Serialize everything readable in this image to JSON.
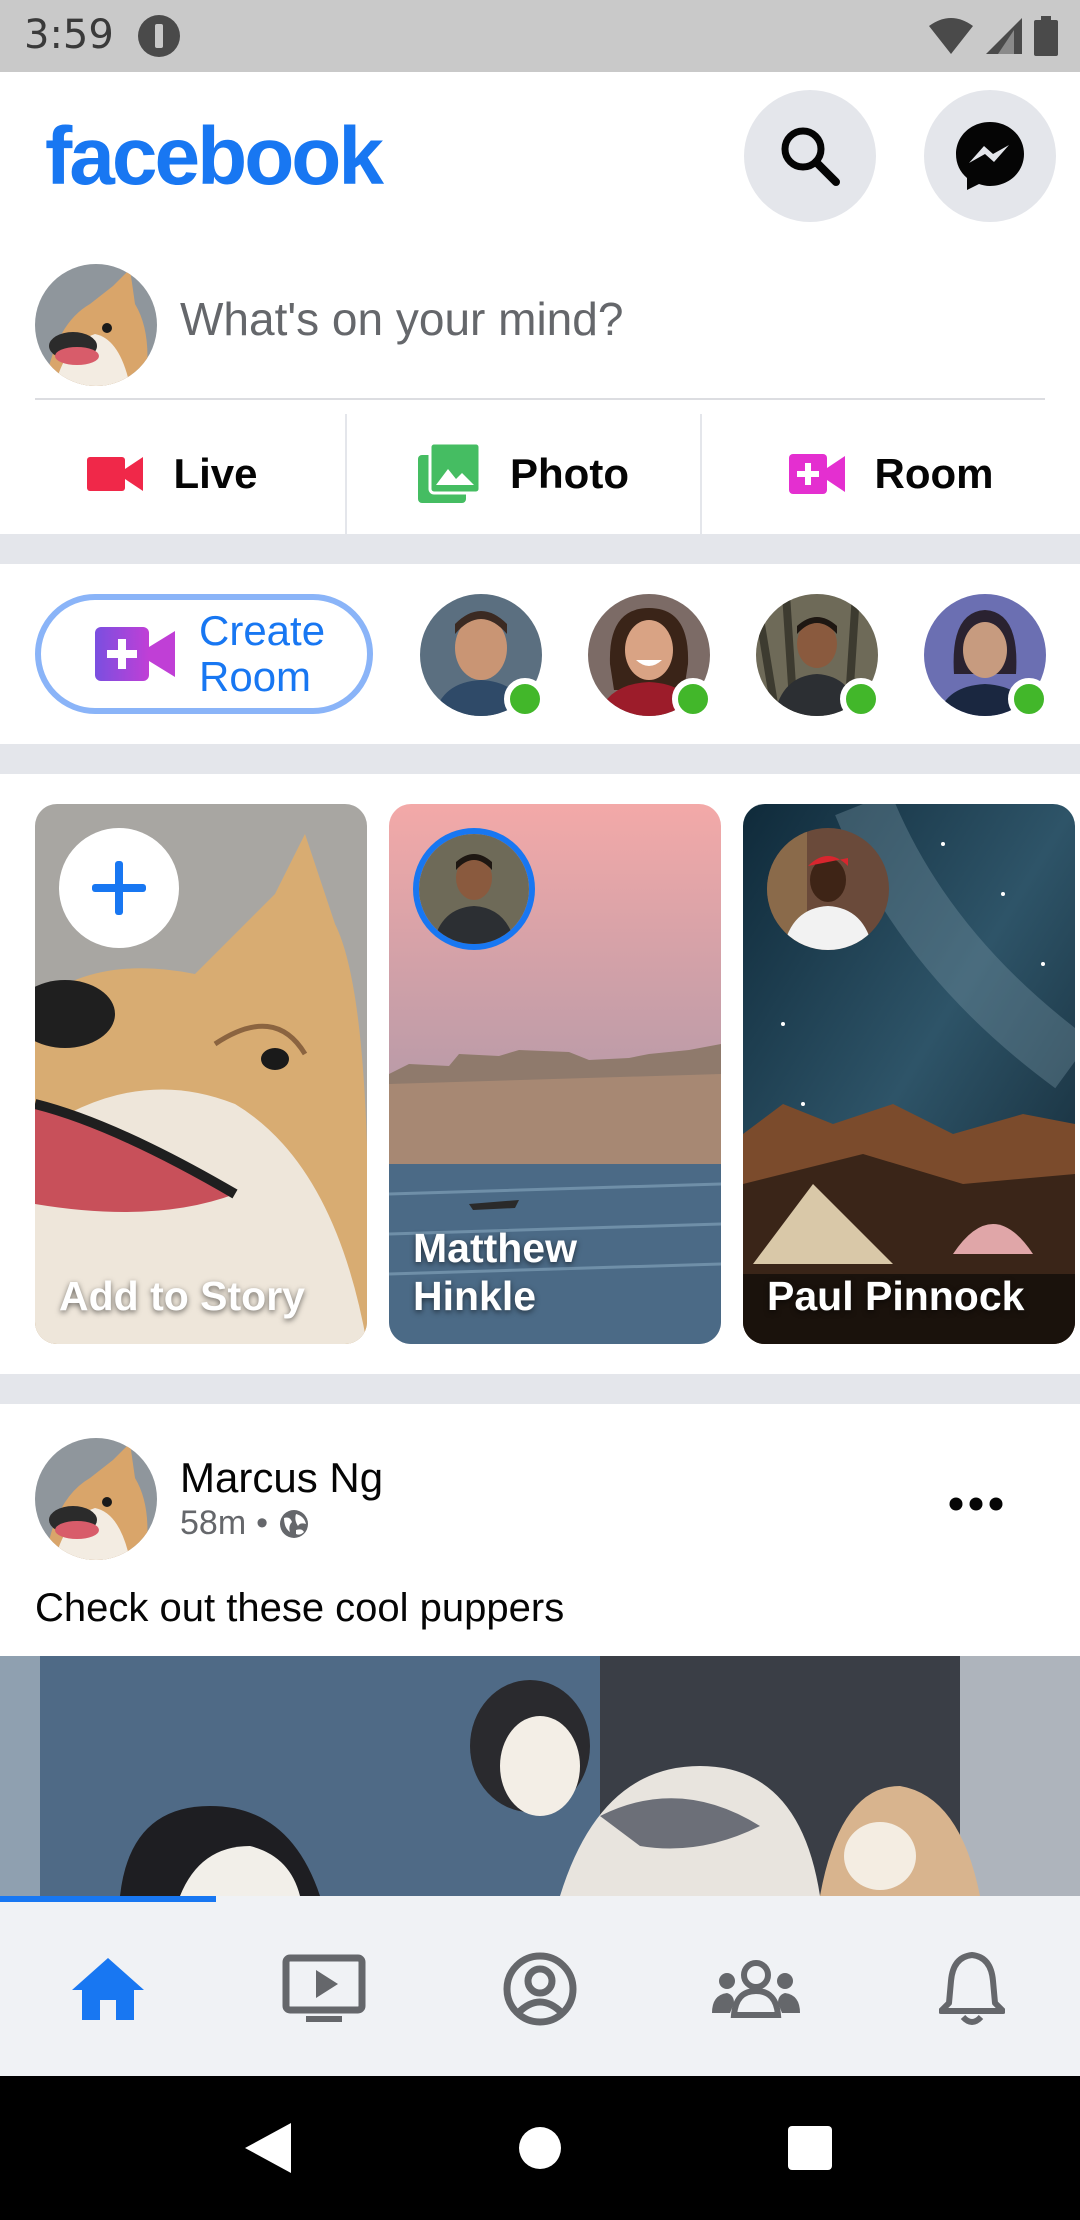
{
  "status_bar": {
    "time": "3:59",
    "icons": [
      "notification-icon",
      "wifi-icon",
      "signal-icon",
      "battery-icon"
    ]
  },
  "header": {
    "logo": "facebook",
    "search_icon": "search-icon",
    "messenger_icon": "messenger-icon"
  },
  "composer": {
    "placeholder": "What's on your mind?",
    "actions": [
      {
        "label": "Live",
        "icon": "video-camera-icon",
        "color": "#f02849"
      },
      {
        "label": "Photo",
        "icon": "photo-icon",
        "color": "#45bd62"
      },
      {
        "label": "Room",
        "icon": "room-icon",
        "color": "#e42fd0"
      }
    ]
  },
  "rooms": {
    "create_line1": "Create",
    "create_line2": "Room",
    "contacts_online": 4
  },
  "stories": [
    {
      "name": "Add to Story",
      "type": "add"
    },
    {
      "name": "Matthew Hinkle",
      "type": "story",
      "unseen": true
    },
    {
      "name": "Paul Pinnock",
      "type": "story",
      "unseen": false
    }
  ],
  "post": {
    "author": "Marcus Ng",
    "time": "58m",
    "separator": "•",
    "privacy_icon": "globe-icon",
    "text": "Check out these cool puppers"
  },
  "bottom_nav": {
    "items": [
      "home-icon",
      "watch-icon",
      "profile-icon",
      "groups-icon",
      "notifications-icon"
    ],
    "active_index": 0
  },
  "colors": {
    "brand": "#1877f2",
    "background_gap": "#e4e6eb",
    "online": "#42b72a"
  }
}
